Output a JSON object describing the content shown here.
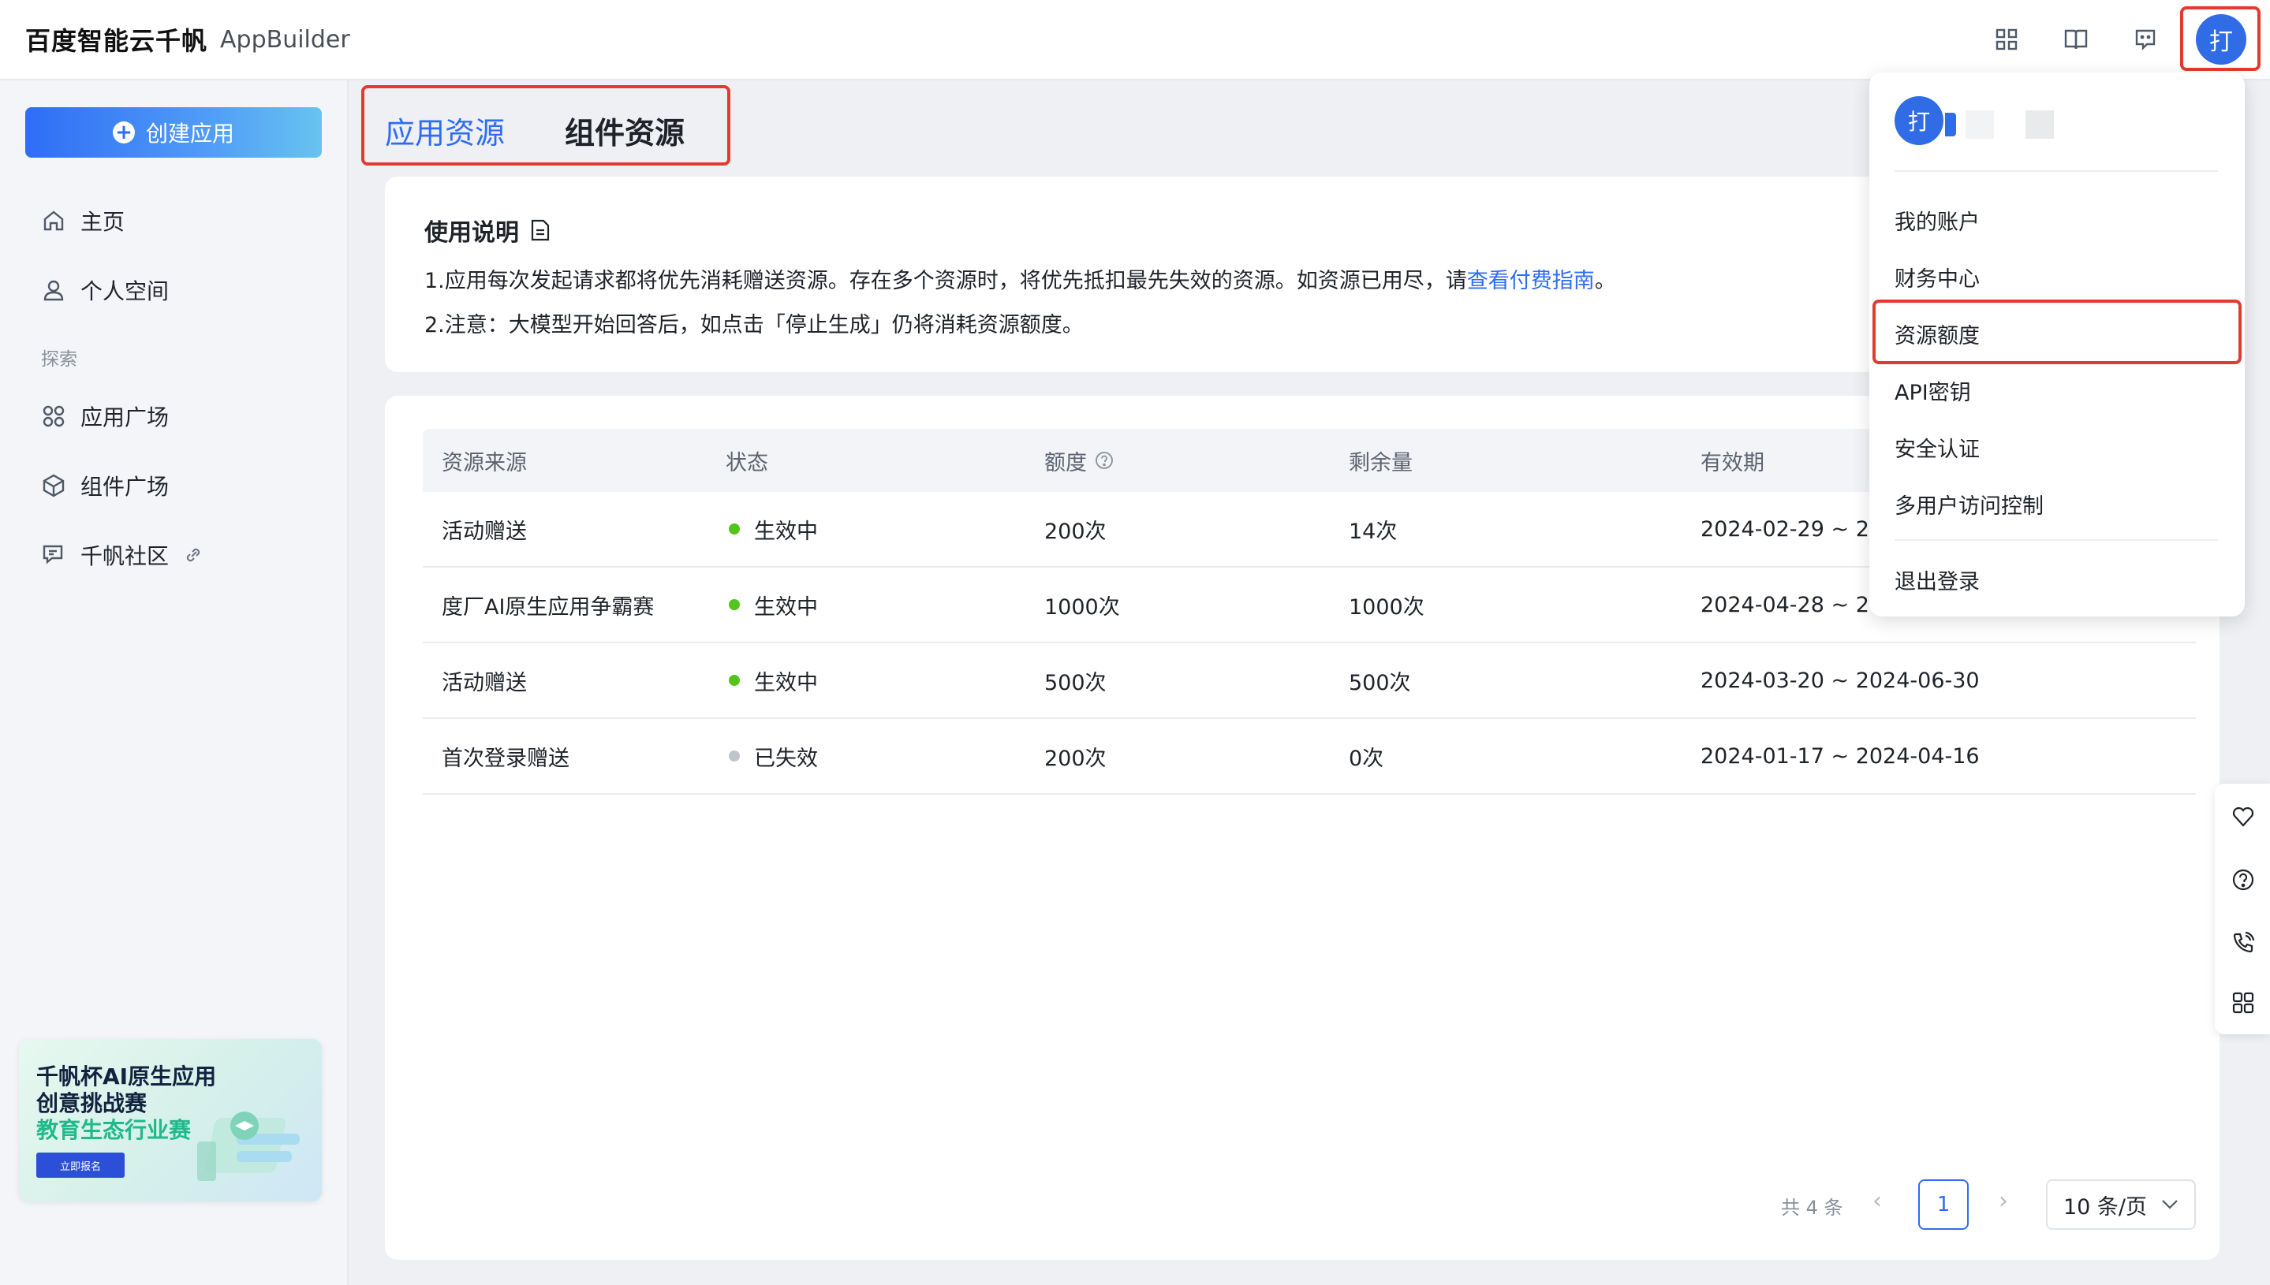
{
  "header": {
    "brand": "百度智能云千帆",
    "product": "AppBuilder",
    "icons": [
      "apps-grid-icon",
      "book-icon",
      "feedback-icon"
    ],
    "avatar_text": "打"
  },
  "sidebar": {
    "create_button": "创建应用",
    "items": [
      {
        "label": "主页",
        "icon": "home-icon"
      },
      {
        "label": "个人空间",
        "icon": "user-icon"
      }
    ],
    "section_label": "探索",
    "explore_items": [
      {
        "label": "应用广场",
        "icon": "grid-icon"
      },
      {
        "label": "组件广场",
        "icon": "cube-icon"
      },
      {
        "label": "千帆社区",
        "icon": "community-icon"
      }
    ],
    "banner": {
      "line1": "千帆杯AI原生应用",
      "line2": "创意挑战赛",
      "line3": "教育生态行业赛",
      "button": "立即报名"
    }
  },
  "tabs": [
    {
      "label": "应用资源",
      "active": true
    },
    {
      "label": "组件资源",
      "active": false
    }
  ],
  "instructions": {
    "title": "使用说明",
    "line1_prefix": "1.应用每次发起请求都将优先消耗赠送资源。存在多个资源时，将优先抵扣最先失效的资源。如资源已用尽，请",
    "line1_link": "查看付费指南",
    "line1_suffix": "。",
    "line2": "2.注意：大模型开始回答后，如点击「停止生成」仍将消耗资源额度。"
  },
  "table": {
    "columns": [
      "资源来源",
      "状态",
      "额度",
      "剩余量",
      "有效期"
    ],
    "rows": [
      {
        "source": "活动赠送",
        "status": "生效中",
        "status_color": "#52c41a",
        "quota": "200次",
        "remaining": "14次",
        "validity": "2024-02-29 ~ 2"
      },
      {
        "source": "度厂AI原生应用争霸赛",
        "status": "生效中",
        "status_color": "#52c41a",
        "quota": "1000次",
        "remaining": "1000次",
        "validity": "2024-04-28 ~ 2"
      },
      {
        "source": "活动赠送",
        "status": "生效中",
        "status_color": "#52c41a",
        "quota": "500次",
        "remaining": "500次",
        "validity": "2024-03-20 ~ 2024-06-30"
      },
      {
        "source": "首次登录赠送",
        "status": "已失效",
        "status_color": "#c0c4cc",
        "quota": "200次",
        "remaining": "0次",
        "validity": "2024-01-17 ~ 2024-04-16"
      }
    ]
  },
  "pagination": {
    "total": "共 4 条",
    "current_page": "1",
    "page_size": "10 条/页"
  },
  "user_menu": {
    "avatar_text": "打",
    "items": [
      "我的账户",
      "财务中心",
      "资源额度",
      "API密钥",
      "安全认证",
      "多用户访问控制"
    ],
    "logout": "退出登录"
  },
  "colors": {
    "accent": "#2e6cf5",
    "highlight_border": "#e33a2f",
    "active_status": "#52c41a",
    "inactive_status": "#c0c4cc"
  }
}
